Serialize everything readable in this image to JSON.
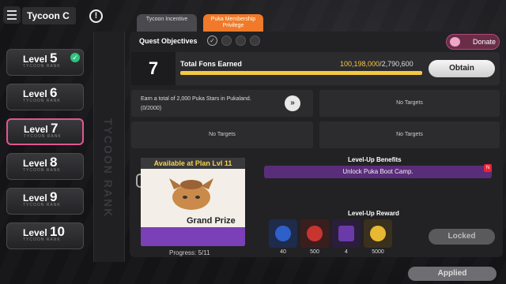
{
  "header": {
    "title": "Tycoon C",
    "info_icon": "info-icon",
    "menu_icon": "menu-icon"
  },
  "levels": [
    {
      "prefix": "Level",
      "number": "5",
      "sub": "TYCOON RANK",
      "completed": true
    },
    {
      "prefix": "Level",
      "number": "6",
      "sub": "TYCOON RANK",
      "completed": false
    },
    {
      "prefix": "Level",
      "number": "7",
      "sub": "TYCOON RANK",
      "completed": false,
      "selected": true
    },
    {
      "prefix": "Level",
      "number": "8",
      "sub": "TYCOON RANK",
      "completed": false
    },
    {
      "prefix": "Level",
      "number": "9",
      "sub": "TYCOON RANK",
      "completed": false
    },
    {
      "prefix": "Level",
      "number": "10",
      "sub": "TYCOON RANK",
      "completed": false
    }
  ],
  "rank_strip_text": "TYCOON RANK",
  "tabs": [
    {
      "label": "Tycoon Incentive"
    },
    {
      "label": "Puka Membership Privilege"
    }
  ],
  "quest": {
    "label": "Quest Objectives",
    "donate_label": "Donate",
    "current_level": "7",
    "fons_label": "Total Fons Earned",
    "fons_current": "100,198,000",
    "fons_target": "/2,790,600",
    "fons_progress": 1.0,
    "obtain_label": "Obtain",
    "cells": [
      {
        "text_line1": "Earn a total of 2,000 Puka Stars in Pukaland.",
        "text_line2": "(0/2000)",
        "go": "»"
      },
      {
        "text": "No Targets"
      },
      {
        "text": "No Targets"
      },
      {
        "text": "No Targets"
      }
    ]
  },
  "prize": {
    "banner": "Available at Plan Lvl 11",
    "title": "Grand Prize",
    "progress": "Progress: 5/11"
  },
  "benefits": {
    "title": "Level-Up Benefits",
    "item": "Unlock Puka Boot Camp.",
    "badge": "N"
  },
  "rewards": {
    "title": "Level-Up Reward",
    "items": [
      {
        "qty": "40",
        "color": "#2f5fc8",
        "icon": "blue-orb-icon"
      },
      {
        "qty": "500",
        "color": "#c8352f",
        "icon": "red-token-icon"
      },
      {
        "qty": "4",
        "color": "#6a3aa8",
        "icon": "ticket-icon"
      },
      {
        "qty": "5000",
        "color": "#e8b832",
        "icon": "gold-coin-icon"
      }
    ],
    "locked_label": "Locked"
  },
  "applied_label": "Applied"
}
